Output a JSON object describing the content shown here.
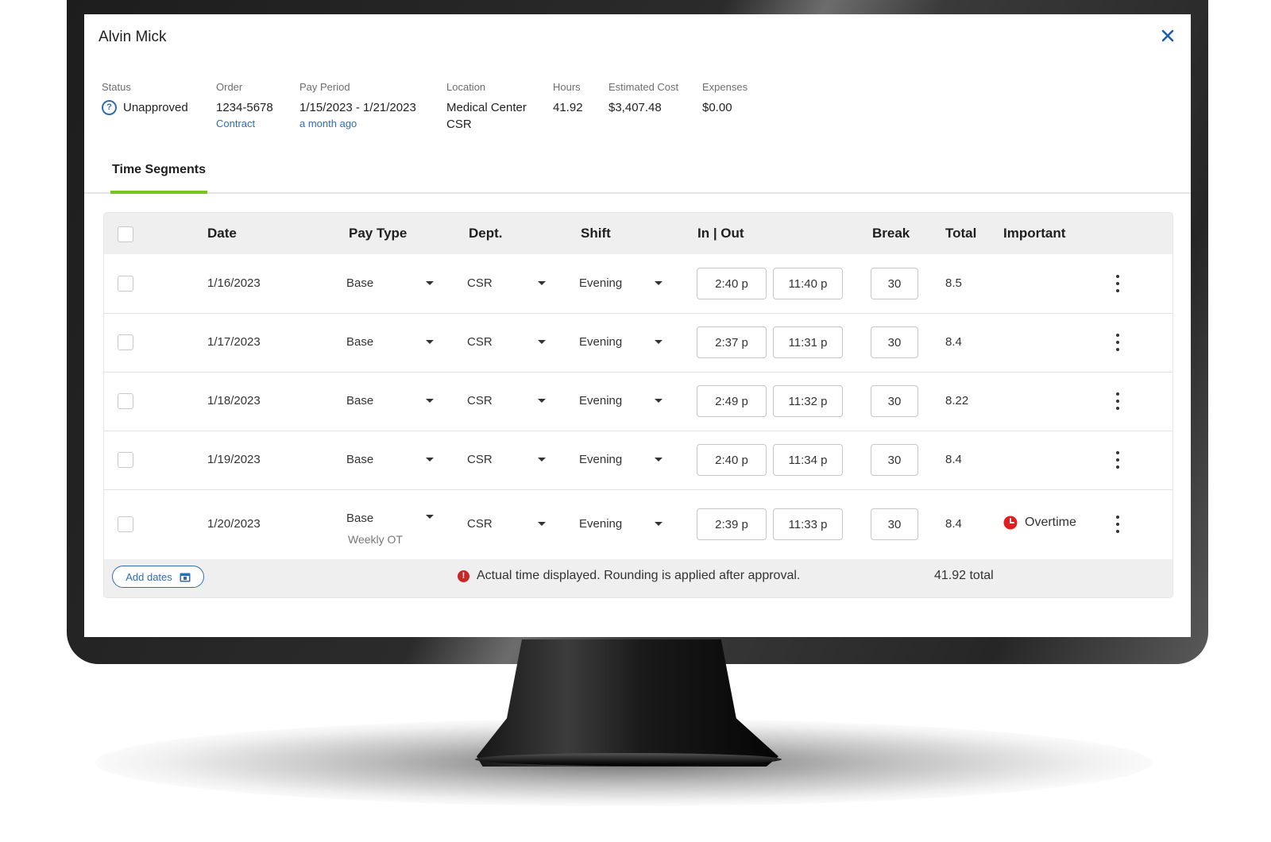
{
  "header": {
    "person_name": "Alvin Mick",
    "close_label": "×"
  },
  "summary": {
    "status": {
      "label": "Status",
      "value": "Unapproved"
    },
    "order": {
      "label": "Order",
      "value": "1234-5678",
      "sub": "Contract"
    },
    "pay_period": {
      "label": "Pay Period",
      "value": "1/15/2023 - 1/21/2023",
      "sub": "a month ago"
    },
    "location": {
      "label": "Location",
      "value_line1": "Medical Center",
      "value_line2": "CSR"
    },
    "hours": {
      "label": "Hours",
      "value": "41.92"
    },
    "estimated_cost": {
      "label": "Estimated Cost",
      "value": "$3,407.48"
    },
    "expenses": {
      "label": "Expenses",
      "value": "$0.00"
    }
  },
  "tabs": [
    {
      "label": "Time Segments",
      "active": true
    }
  ],
  "table": {
    "columns": [
      "Date",
      "Pay Type",
      "Dept.",
      "Shift",
      "In | Out",
      "Break",
      "Total",
      "Important"
    ],
    "rows": [
      {
        "date": "1/16/2023",
        "pay_type": "Base",
        "dept": "CSR",
        "shift": "Evening",
        "in": "2:40 p",
        "out": "11:40 p",
        "break": "30",
        "total": "8.5",
        "important": ""
      },
      {
        "date": "1/17/2023",
        "pay_type": "Base",
        "dept": "CSR",
        "shift": "Evening",
        "in": "2:37 p",
        "out": "11:31 p",
        "break": "30",
        "total": "8.4",
        "important": ""
      },
      {
        "date": "1/18/2023",
        "pay_type": "Base",
        "dept": "CSR",
        "shift": "Evening",
        "in": "2:49 p",
        "out": "11:32 p",
        "break": "30",
        "total": "8.22",
        "important": ""
      },
      {
        "date": "1/19/2023",
        "pay_type": "Base",
        "dept": "CSR",
        "shift": "Evening",
        "in": "2:40 p",
        "out": "11:34 p",
        "break": "30",
        "total": "8.4",
        "important": ""
      },
      {
        "date": "1/20/2023",
        "pay_type": "Base",
        "pay_type_sub": "Weekly OT",
        "dept": "CSR",
        "shift": "Evening",
        "in": "2:39 p",
        "out": "11:33 p",
        "break": "30",
        "total": "8.4",
        "important": "Overtime"
      }
    ]
  },
  "footer": {
    "add_dates_label": "Add dates",
    "notice": "Actual time displayed. Rounding is applied after approval.",
    "total": "41.92 total"
  },
  "colors": {
    "accent_blue": "#2e6db4",
    "tab_underline": "#7ac31f",
    "alert_red": "#c62828",
    "overtime_red": "#e01e1e"
  },
  "icons": {
    "close": "close-icon",
    "status": "help-icon",
    "row_menu": "kebab-icon",
    "dropdown": "caret-icon",
    "calendar": "calendar-icon",
    "alert": "alert-icon",
    "overtime": "clock-icon"
  }
}
